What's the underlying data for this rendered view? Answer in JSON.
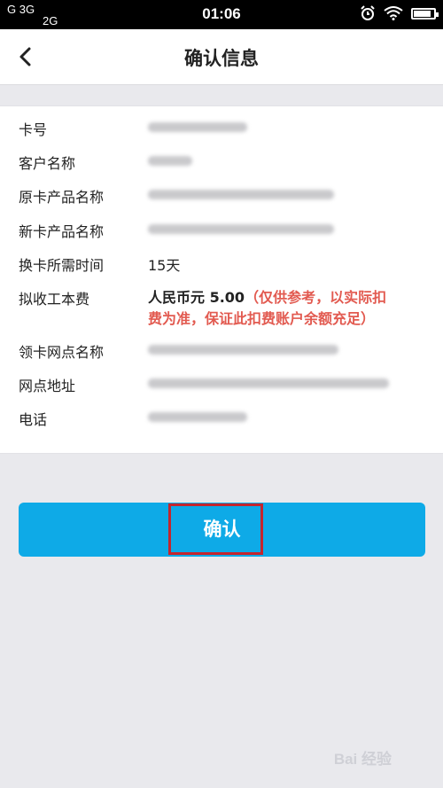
{
  "status_bar": {
    "network": "Gᵢᵢ 3G\n2G",
    "net_top": "G 3G",
    "net_bottom": "2G",
    "time": "01:06"
  },
  "nav": {
    "title": "确认信息"
  },
  "rows": [
    {
      "label": "卡号"
    },
    {
      "label": "客户名称"
    },
    {
      "label": "原卡产品名称"
    },
    {
      "label": "新卡产品名称"
    },
    {
      "label": "换卡所需时间",
      "value": "15天"
    },
    {
      "label": "拟收工本费",
      "value_prefix": "人民币元 5.00",
      "value_note_1": "（仅供参考，以实际扣",
      "value_note_2": "费为准，保证此扣费账户余额充足）"
    },
    {
      "label": "领卡网点名称"
    },
    {
      "label": "网点地址"
    },
    {
      "label": "电话"
    }
  ],
  "confirm_button": {
    "label": "确认"
  },
  "watermark": {
    "text": "Bai 经验"
  },
  "colors": {
    "accent": "#0eaae7",
    "note": "#e25a50",
    "highlight": "#c4252d"
  }
}
